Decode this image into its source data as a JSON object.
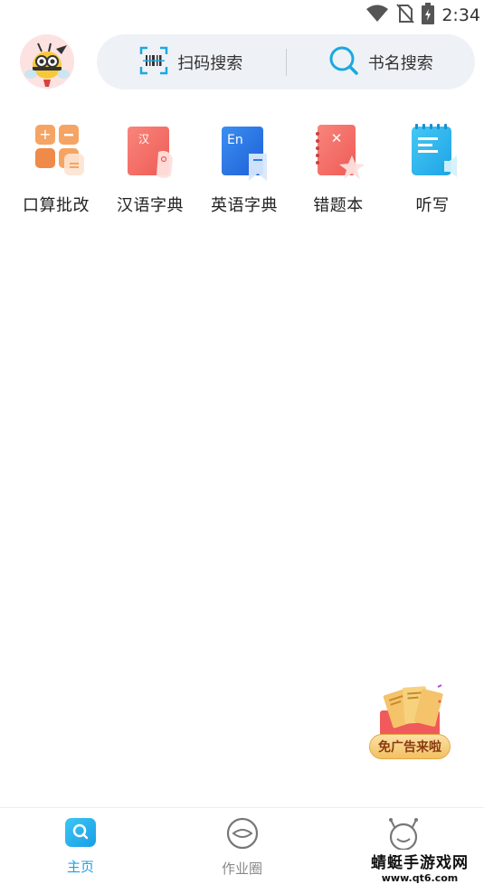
{
  "status_bar": {
    "time": "2:34",
    "icons": [
      "wifi-icon",
      "no-sim-icon",
      "battery-icon"
    ]
  },
  "header": {
    "avatar": "bee-avatar",
    "search": {
      "scan_label": "扫码搜索",
      "name_label": "书名搜索"
    }
  },
  "tools": [
    {
      "label": "口算批改",
      "icon": "calculator-icon",
      "color": "#f59a5a"
    },
    {
      "label": "汉语字典",
      "icon": "chinese-dictionary-icon",
      "color": "#f26a63",
      "glyph": "汉"
    },
    {
      "label": "英语字典",
      "icon": "english-dictionary-icon",
      "color": "#2f7ee8",
      "glyph": "En"
    },
    {
      "label": "错题本",
      "icon": "mistake-notebook-icon",
      "color": "#f26a63",
      "glyph": "✕"
    },
    {
      "label": "听写",
      "icon": "dictation-icon",
      "color": "#2fb8f0"
    }
  ],
  "ad": {
    "label": "免广告来啦"
  },
  "bottom_nav": [
    {
      "label": "主页",
      "icon": "home-search-icon",
      "active": true
    },
    {
      "label": "作业圈",
      "icon": "homework-circle-icon",
      "active": false
    },
    {
      "label": "",
      "icon": "profile-face-icon",
      "active": false
    }
  ],
  "watermark": {
    "title": "蜻蜓手游戏网",
    "url": "www.qt6.com"
  },
  "colors": {
    "accent": "#1fa0e8",
    "search_bg": "#eef2f6",
    "scan_icon": "#1aa9e0"
  }
}
